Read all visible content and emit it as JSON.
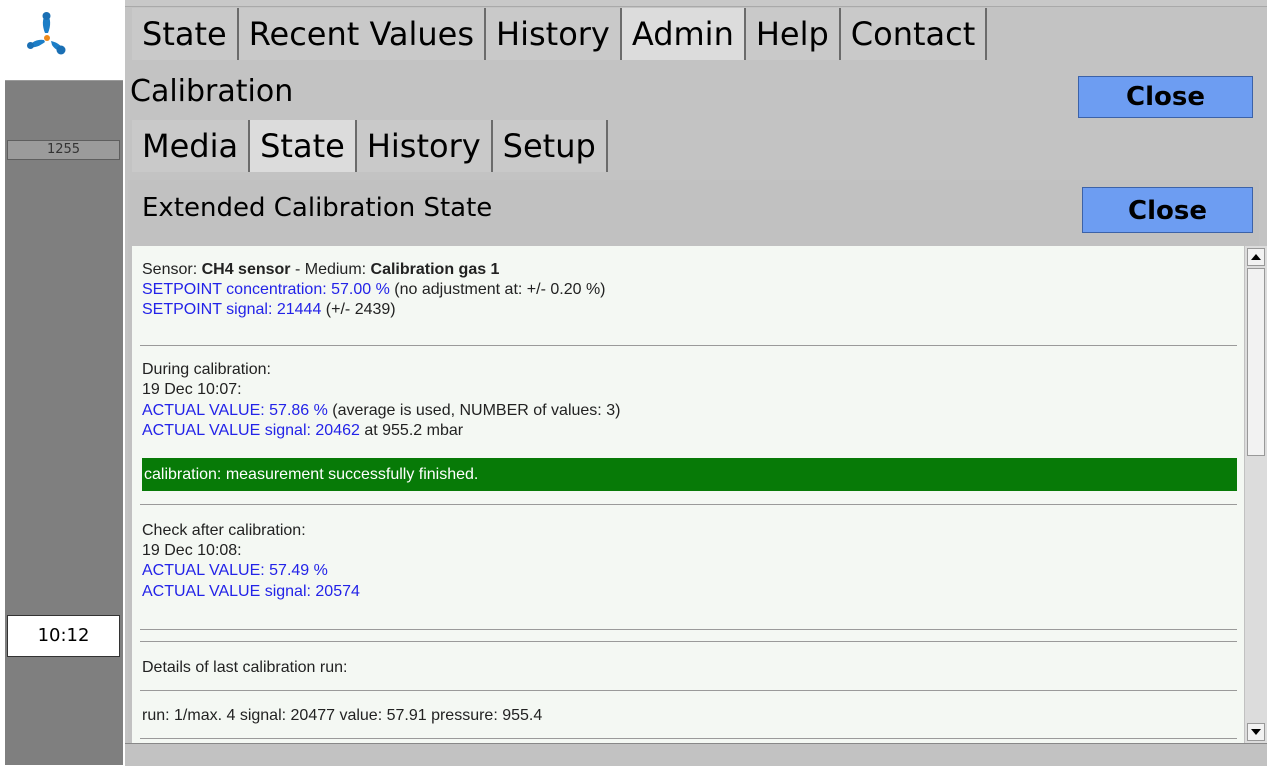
{
  "sidebar": {
    "counter": "1255",
    "clock": "10:12",
    "logo_icon": "propeller-logo-icon"
  },
  "nav": {
    "tabs": [
      {
        "label": "State"
      },
      {
        "label": "Recent Values"
      },
      {
        "label": "History"
      },
      {
        "label": "Admin",
        "active": true
      },
      {
        "label": "Help"
      },
      {
        "label": "Contact"
      }
    ]
  },
  "calibration": {
    "title": "Calibration",
    "close_label": "Close",
    "tabs": [
      {
        "label": "Media"
      },
      {
        "label": "State",
        "active": true
      },
      {
        "label": "History"
      },
      {
        "label": "Setup"
      }
    ]
  },
  "panel": {
    "title": "Extended Calibration State",
    "close_label": "Close",
    "sensor": {
      "prefix": "Sensor: ",
      "name": "CH4 sensor",
      "medium_prefix": " - Medium: ",
      "medium": "Calibration gas 1"
    },
    "setpoint_conc": {
      "label": "SETPOINT concentration: 57.00 %",
      "note": " (no adjustment at: +/- 0.20 %)"
    },
    "setpoint_signal": {
      "label": "SETPOINT signal: 21444",
      "note": " (+/- 2439)"
    },
    "during": {
      "heading": "During calibration:",
      "time": "19 Dec 10:07:",
      "actual_value": "ACTUAL VALUE: 57.86 %",
      "actual_value_note": " (average is used, NUMBER of values: 3)",
      "actual_signal": "ACTUAL VALUE signal: 20462",
      "actual_signal_note": " at 955.2 mbar",
      "status": "calibration: measurement successfully finished."
    },
    "check": {
      "heading": "Check after calibration:",
      "time": "19 Dec 10:08:",
      "actual_value": "ACTUAL VALUE: 57.49 %",
      "actual_signal": "ACTUAL VALUE signal: 20574"
    },
    "details": {
      "heading": "Details of last calibration run:",
      "run": "run: 1/max. 4 signal: 20477 value: 57.91 pressure: 955.4"
    }
  },
  "colors": {
    "accent": "#6d9df2",
    "success": "#077a07",
    "link": "#2323e8"
  }
}
